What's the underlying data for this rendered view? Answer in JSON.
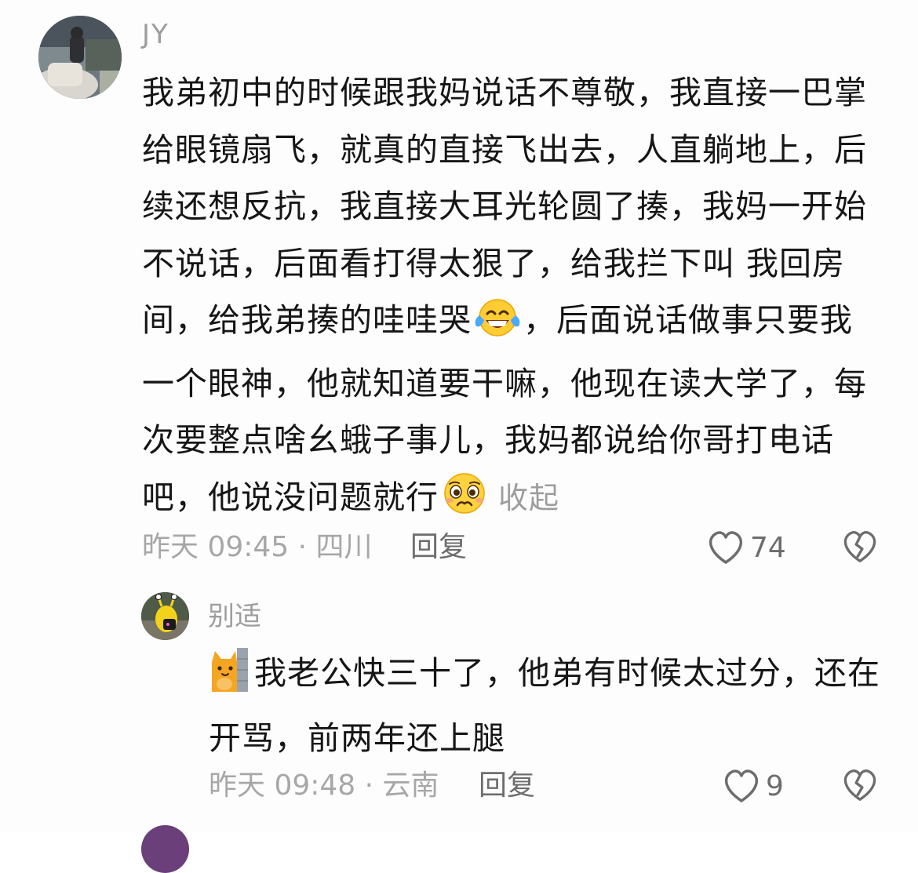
{
  "comment": {
    "username": "JY",
    "avatar_icon": "user-photo-avatar",
    "text_part1": "我弟初中的时候跟我妈说话不尊敬，我直接一巴掌给眼镜扇飞，就真的直接飞出去，人直躺地上，后续还想反抗，我直接大耳光轮圆了揍，我妈一开始不说话，后面看打得太狠了，给我拦下叫 我回房间，给我弟揍的哇哇哭",
    "emoji1": "laughing-tears-emoji",
    "text_part2": "，后面说话做事只要我一个眼神，他就知道要干嘛，他现在读大学了，每次要整点啥幺蛾子事儿，我妈都说给你哥打电话吧，他说没问题就行",
    "emoji2": "pleading-emoji",
    "collapse_label": "收起",
    "meta": "昨天 09:45 · 四川",
    "reply_label": "回复",
    "like_count": "74",
    "like_icon": "heart-icon",
    "dislike_icon": "broken-heart-icon"
  },
  "reply": {
    "username": "别适",
    "avatar_icon": "snail-avatar",
    "emoji": "cat-peeking-emoji",
    "text": "我老公快三十了，他弟有时候太过分，还在开骂，前两年还上腿",
    "meta": "昨天 09:48 · 云南",
    "reply_label": "回复",
    "like_count": "9",
    "like_icon": "heart-icon",
    "dislike_icon": "broken-heart-icon"
  },
  "colors": {
    "text_primary": "#161616",
    "text_secondary": "#9d9d9d",
    "text_action": "#6d6d6d"
  }
}
